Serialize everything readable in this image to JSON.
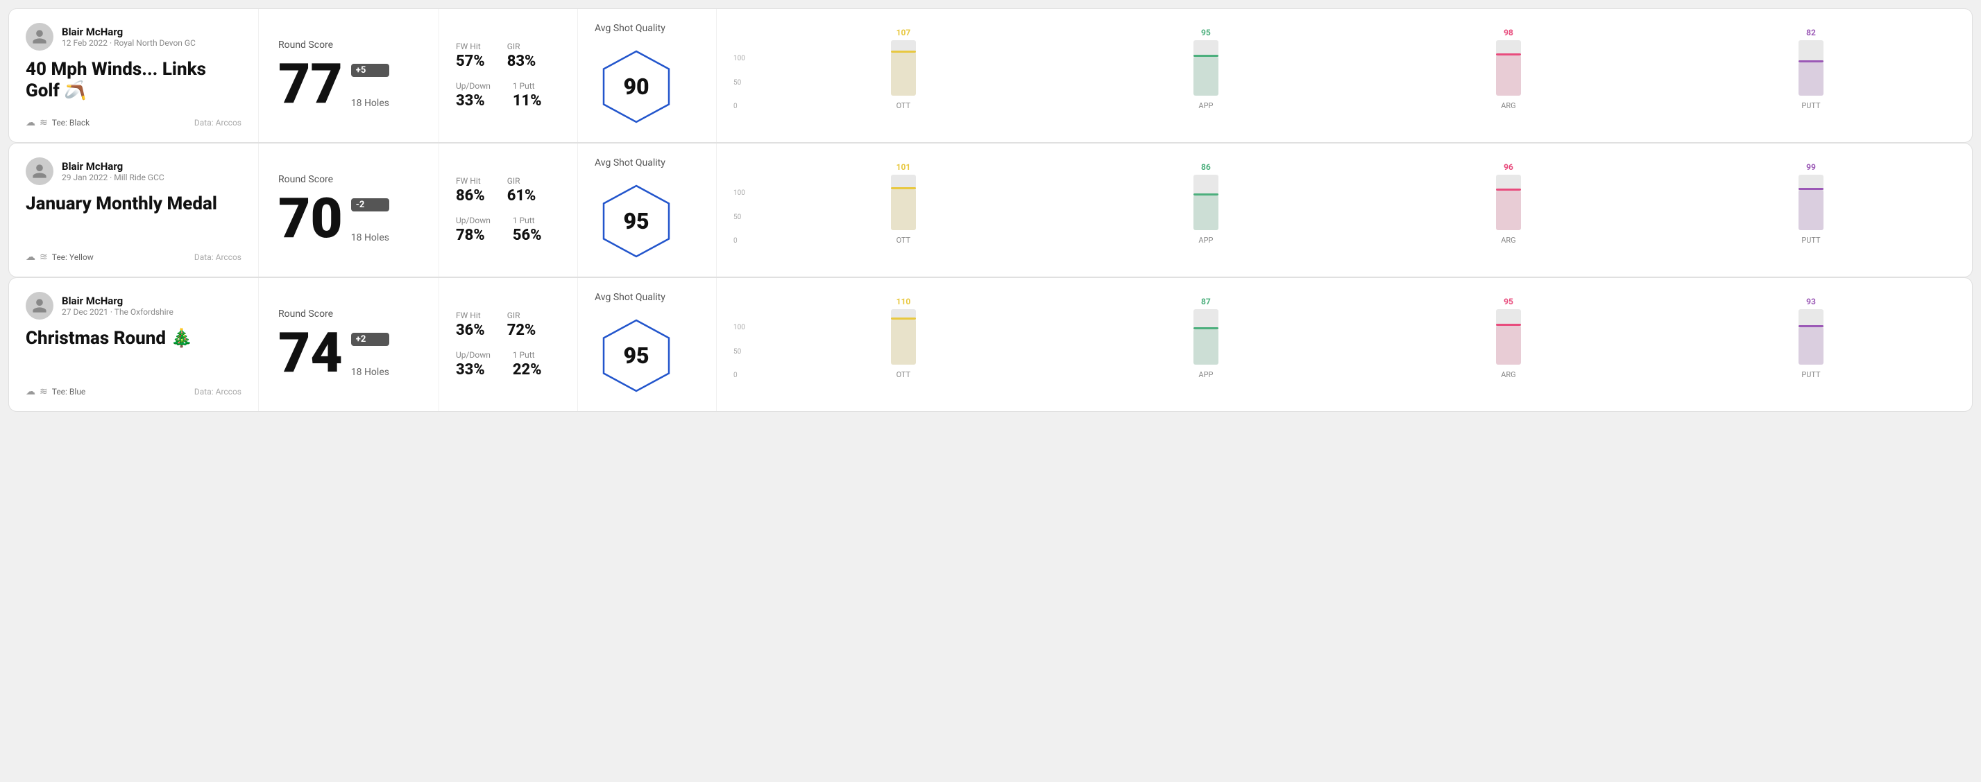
{
  "rounds": [
    {
      "id": "round1",
      "player": {
        "name": "Blair McHarg",
        "date": "12 Feb 2022",
        "course": "Royal North Devon GC"
      },
      "title": "40 Mph Winds... Links Golf 🪃",
      "tee": "Black",
      "dataSource": "Data: Arccos",
      "score": {
        "label": "Round Score",
        "value": "77",
        "badge": "+5",
        "holes": "18 Holes"
      },
      "stats": {
        "fwHit": {
          "label": "FW Hit",
          "value": "57%"
        },
        "gir": {
          "label": "GIR",
          "value": "83%"
        },
        "upDown": {
          "label": "Up/Down",
          "value": "33%"
        },
        "onePutt": {
          "label": "1 Putt",
          "value": "11%"
        }
      },
      "quality": {
        "label": "Avg Shot Quality",
        "score": "90"
      },
      "chart": {
        "bars": [
          {
            "label": "OTT",
            "value": 107,
            "colorClass": "ott",
            "pct": 78
          },
          {
            "label": "APP",
            "value": 95,
            "colorClass": "app",
            "pct": 70
          },
          {
            "label": "ARG",
            "value": 98,
            "colorClass": "arg",
            "pct": 72
          },
          {
            "label": "PUTT",
            "value": 82,
            "colorClass": "putt",
            "pct": 60
          }
        ],
        "yLabels": [
          "100",
          "50",
          "0"
        ]
      }
    },
    {
      "id": "round2",
      "player": {
        "name": "Blair McHarg",
        "date": "29 Jan 2022",
        "course": "Mill Ride GCC"
      },
      "title": "January Monthly Medal",
      "tee": "Yellow",
      "dataSource": "Data: Arccos",
      "score": {
        "label": "Round Score",
        "value": "70",
        "badge": "-2",
        "holes": "18 Holes"
      },
      "stats": {
        "fwHit": {
          "label": "FW Hit",
          "value": "86%"
        },
        "gir": {
          "label": "GIR",
          "value": "61%"
        },
        "upDown": {
          "label": "Up/Down",
          "value": "78%"
        },
        "onePutt": {
          "label": "1 Putt",
          "value": "56%"
        }
      },
      "quality": {
        "label": "Avg Shot Quality",
        "score": "95"
      },
      "chart": {
        "bars": [
          {
            "label": "OTT",
            "value": 101,
            "colorClass": "ott",
            "pct": 74
          },
          {
            "label": "APP",
            "value": 86,
            "colorClass": "app",
            "pct": 63
          },
          {
            "label": "ARG",
            "value": 96,
            "colorClass": "arg",
            "pct": 71
          },
          {
            "label": "PUTT",
            "value": 99,
            "colorClass": "putt",
            "pct": 73
          }
        ],
        "yLabels": [
          "100",
          "50",
          "0"
        ]
      }
    },
    {
      "id": "round3",
      "player": {
        "name": "Blair McHarg",
        "date": "27 Dec 2021",
        "course": "The Oxfordshire"
      },
      "title": "Christmas Round 🎄",
      "tee": "Blue",
      "dataSource": "Data: Arccos",
      "score": {
        "label": "Round Score",
        "value": "74",
        "badge": "+2",
        "holes": "18 Holes"
      },
      "stats": {
        "fwHit": {
          "label": "FW Hit",
          "value": "36%"
        },
        "gir": {
          "label": "GIR",
          "value": "72%"
        },
        "upDown": {
          "label": "Up/Down",
          "value": "33%"
        },
        "onePutt": {
          "label": "1 Putt",
          "value": "22%"
        }
      },
      "quality": {
        "label": "Avg Shot Quality",
        "score": "95"
      },
      "chart": {
        "bars": [
          {
            "label": "OTT",
            "value": 110,
            "colorClass": "ott",
            "pct": 81
          },
          {
            "label": "APP",
            "value": 87,
            "colorClass": "app",
            "pct": 64
          },
          {
            "label": "ARG",
            "value": 95,
            "colorClass": "arg",
            "pct": 70
          },
          {
            "label": "PUTT",
            "value": 93,
            "colorClass": "putt",
            "pct": 68
          }
        ],
        "yLabels": [
          "100",
          "50",
          "0"
        ]
      }
    }
  ]
}
